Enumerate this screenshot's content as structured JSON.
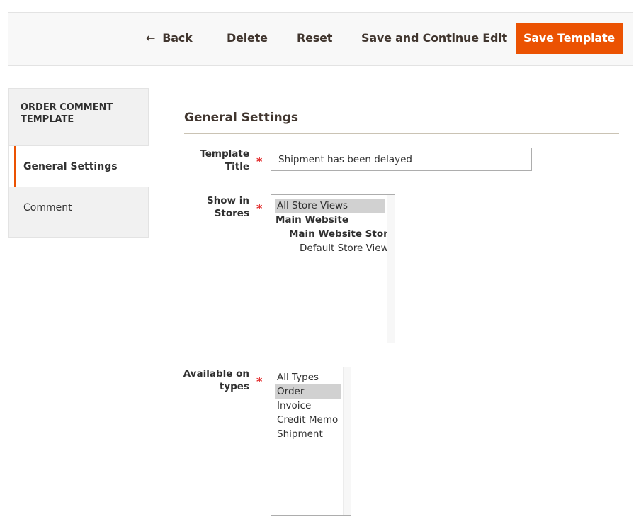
{
  "toolbar": {
    "back_label": "Back",
    "back_icon": "arrow-left-icon",
    "delete_label": "Delete",
    "reset_label": "Reset",
    "save_continue_label": "Save and Continue Edit",
    "save_label": "Save Template",
    "accent_color": "#eb5202"
  },
  "sidebar": {
    "title": "ORDER COMMENT TEMPLATE",
    "items": [
      {
        "label": "General Settings",
        "active": true
      },
      {
        "label": "Comment",
        "active": false
      }
    ]
  },
  "main": {
    "section_title": "General Settings",
    "fields": {
      "template_title": {
        "label": "Template Title",
        "required": "*",
        "value": "Shipment has been delayed"
      },
      "show_in_stores": {
        "label": "Show in Stores",
        "required": "*",
        "options": [
          {
            "label": "All Store Views",
            "selected": true,
            "level": 0
          },
          {
            "label": "Main Website",
            "selected": false,
            "level": 1
          },
          {
            "label": "Main Website Store",
            "selected": false,
            "level": 2
          },
          {
            "label": "Default Store View",
            "selected": false,
            "level": 3
          }
        ]
      },
      "available_on_types": {
        "label": "Available on types",
        "required": "*",
        "options": [
          {
            "label": "All Types",
            "selected": false
          },
          {
            "label": "Order",
            "selected": true
          },
          {
            "label": "Invoice",
            "selected": false
          },
          {
            "label": "Credit Memo",
            "selected": false
          },
          {
            "label": "Shipment",
            "selected": false
          }
        ]
      }
    }
  }
}
